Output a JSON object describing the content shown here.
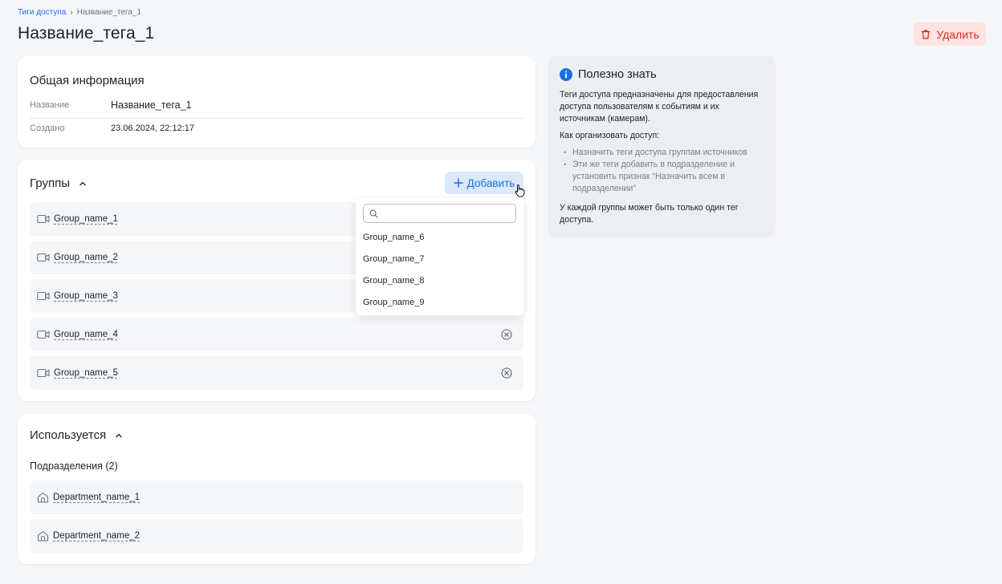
{
  "breadcrumb": {
    "parent": "Тиги доступа",
    "separator": "›",
    "current": "Название_тега_1"
  },
  "page": {
    "title": "Название_тега_1",
    "delete_label": "Удалить"
  },
  "general": {
    "title": "Общая информация",
    "rows": [
      {
        "label": "Название",
        "value": "Название_тега_1"
      },
      {
        "label": "Создано",
        "value": "23.06.2024, 22:12:17"
      }
    ]
  },
  "groups": {
    "title": "Группы",
    "add_label": "Добавить",
    "items": [
      {
        "label": "Group_name_1"
      },
      {
        "label": "Group_name_2"
      },
      {
        "label": "Group_name_3"
      },
      {
        "label": "Group_name_4"
      },
      {
        "label": "Group_name_5"
      }
    ],
    "dropdown": {
      "search_value": "",
      "search_placeholder": "",
      "options": [
        "Group_name_6",
        "Group_name_7",
        "Group_name_8",
        "Group_name_9"
      ]
    }
  },
  "used": {
    "title": "Используется",
    "subtitle": "Подразделения (2)",
    "items": [
      {
        "label": "Department_name_1"
      },
      {
        "label": "Department_name_2"
      }
    ]
  },
  "info": {
    "title": "Полезно знать",
    "paragraph1": "Теги доступа предназначены для предоставления доступа пользователям к событиям и их источникам (камерам).",
    "paragraph2": "Как организовать доступ:",
    "list": [
      "Назначить теги доступа группам источников",
      "Эти же теги добавить в подразделение и установить признак “Назначить всем в подразделении”"
    ],
    "paragraph3": "У каждой группы может быть только один тег доступа."
  },
  "colors": {
    "accent": "#1a6fe8",
    "danger": "#d92d20",
    "danger_bg": "#fde3e1",
    "add_bg": "#dce9fb"
  }
}
